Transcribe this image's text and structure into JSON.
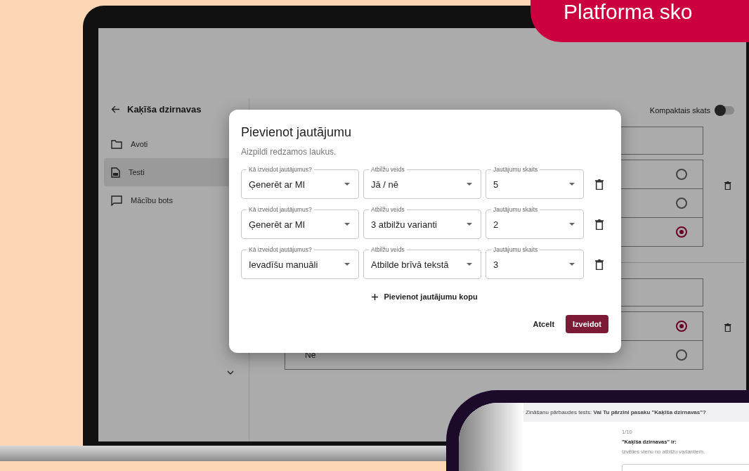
{
  "banner": {
    "text": "Platforma sko"
  },
  "sidebar": {
    "back_title": "Kaķīša dzirnavas",
    "items": [
      {
        "label": "Avoti",
        "kind": "folder",
        "selected": false
      },
      {
        "label": "Testi",
        "kind": "document",
        "selected": true
      },
      {
        "label": "Mācību bots",
        "kind": "chat",
        "selected": false
      }
    ]
  },
  "compact_toggle": {
    "label": "Kompaktais skats",
    "on": false
  },
  "questions": [
    {
      "options": [
        {
          "selected": false
        },
        {
          "selected": false
        },
        {
          "selected": true
        }
      ]
    },
    {
      "options": [
        {
          "selected": true
        },
        {
          "text": "Nē",
          "selected": false
        }
      ]
    }
  ],
  "modal": {
    "title": "Pievienot jautājumu",
    "subtitle": "Aizpildi redzamos laukus.",
    "rows": [
      {
        "fields": [
          {
            "label": "Kā izveidot jautājumus?",
            "value": "Ģenerēt ar MI"
          },
          {
            "label": "Atbilžu veids",
            "value": "Jā / nē"
          },
          {
            "label": "Jautājumu skaits",
            "value": "5"
          }
        ]
      },
      {
        "fields": [
          {
            "label": "Kā izveidot jautājumus?",
            "value": "Ģenerēt ar MI"
          },
          {
            "label": "Atbilžu veids",
            "value": "3 atbilžu varianti"
          },
          {
            "label": "Jautājumu skaits",
            "value": "2"
          }
        ]
      },
      {
        "fields": [
          {
            "label": "Kā izveidot jautājumus?",
            "value": "Ievadīšu manuāli"
          },
          {
            "label": "Atbilžu veids",
            "value": "Atbilde brīvā tekstā"
          },
          {
            "label": "Jautājumu skaits",
            "value": "3"
          }
        ]
      }
    ],
    "add_button": "Pievienot jautājumu kopu",
    "cancel": "Atcelt",
    "submit": "Izveidot"
  },
  "tablet": {
    "header": "Zināšanu pārbaudes tests: **Vai Tu pārzini pasaku \"Kaķīša dzirnavas\"?**",
    "counter": "1/10",
    "question": "\"Kaķīša dzirnavas\" ir:",
    "hint": "Izvēlies vienu no atbilžu variantiem."
  }
}
